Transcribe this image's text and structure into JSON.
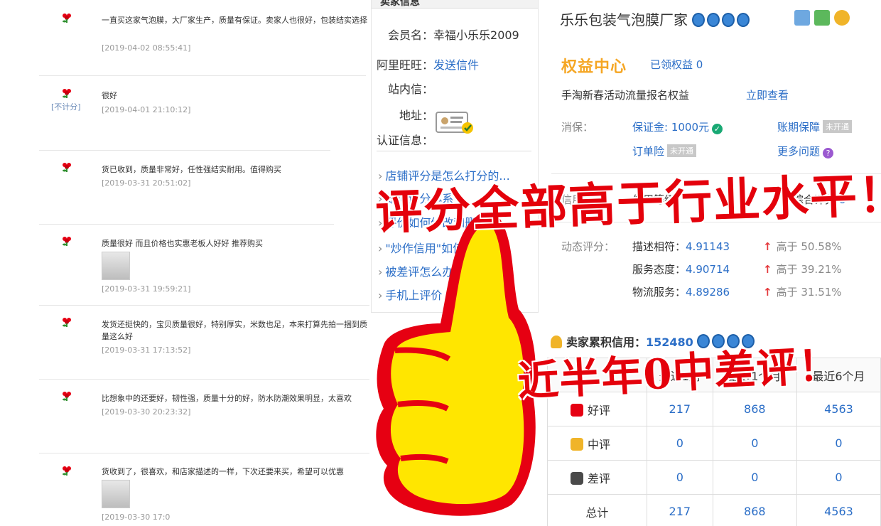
{
  "reviews": [
    {
      "text": "一直买这家气泡膜，大厂家生产，质量有保证。卖家人也很好，包装结实选择",
      "time": "[2019-04-02 08:55:41]",
      "not_scored": ""
    },
    {
      "text": "很好",
      "time": "[2019-04-01 21:10:12]",
      "not_scored": "[不计分]"
    },
    {
      "text": "货已收到，质量非常好，任性强结实耐用。值得购买",
      "time": "[2019-03-31 20:51:02]",
      "not_scored": ""
    },
    {
      "text": "质量很好 而且价格也实惠老板人好好 推荐购买",
      "time": "[2019-03-31 19:59:21]",
      "not_scored": ""
    },
    {
      "text": "发货还挺快的，宝贝质量很好，特别厚实，米数也足，本来打算先拍一捆到质量这么好",
      "time": "[2019-03-31 17:13:52]",
      "not_scored": ""
    },
    {
      "text": "比想象中的还要好，韧性强，质量十分的好，防水防潮效果明显，太喜欢",
      "time": "[2019-03-30 20:23:32]",
      "not_scored": ""
    },
    {
      "text": "货收到了，很喜欢，和店家描述的一样，下次还要来买，希望可以优惠",
      "time": "[2019-03-30 17:0",
      "not_scored": ""
    }
  ],
  "info": {
    "header": "卖家信息",
    "member_label": "会员名：",
    "member_value": "幸福小乐乐2009",
    "wangwang_label": "阿里旺旺：",
    "wangwang_link": "发送信件",
    "station_label": "站内信：",
    "address_label": "地址：",
    "cert_label": "认证信息：",
    "faqs": [
      "店铺评分是怎么打分的...",
      "如何评分体系",
      "评价如何修改和删除",
      "\"炒作信用\"如何",
      "被差评怎么办",
      "手机上评价"
    ]
  },
  "shop": {
    "name": "乐乐包装气泡膜厂家",
    "rights_title": "权益中心",
    "rights_count": "已领权益 0",
    "promo_text": "手淘新春活动流量报名权益",
    "promo_link": "立即查看",
    "consumer_label": "消保：",
    "deposit": "保证金: 1000元",
    "account_guard": "账期保障",
    "not_open": "未开通",
    "order_insurance": "订单险",
    "more_questions": "更多问题",
    "credit_label": "信用：",
    "credit_level": "信用等级",
    "credit_score_label": "综合评分",
    "credit_score": "8",
    "dsr_label": "动态评分：",
    "dsr": [
      {
        "name": "描述相符：",
        "value": "4.91143",
        "higher": "高于 50.58%"
      },
      {
        "name": "服务态度：",
        "value": "4.90714",
        "higher": "高于 39.21%"
      },
      {
        "name": "物流服务：",
        "value": "4.89286",
        "higher": "高于 31.51%"
      }
    ],
    "seller_credit_label": "卖家累积信用：",
    "seller_credit_value": "152480"
  },
  "rating_table": {
    "headers": [
      "",
      "最近1周",
      "最近1个月",
      "最近6个月"
    ],
    "rows": [
      {
        "label": "好评",
        "values": [
          "217",
          "868",
          "4563"
        ]
      },
      {
        "label": "中评",
        "values": [
          "0",
          "0",
          "0"
        ]
      },
      {
        "label": "差评",
        "values": [
          "0",
          "0",
          "0"
        ]
      },
      {
        "label": "总计",
        "values": [
          "217",
          "868",
          "4563"
        ]
      }
    ]
  },
  "overlay": {
    "headline": "评分全部高于行业水平！！",
    "subline": "近半年0中差评！"
  },
  "colors": {
    "accent_blue": "#2b6ec7",
    "red": "#e4010b",
    "orange": "#f5a623",
    "thumb_yellow": "#ffe600"
  },
  "icons": [
    "flower-icon",
    "thumbs-up-icon",
    "crown-icon",
    "check-icon",
    "question-icon",
    "seller-icon"
  ]
}
